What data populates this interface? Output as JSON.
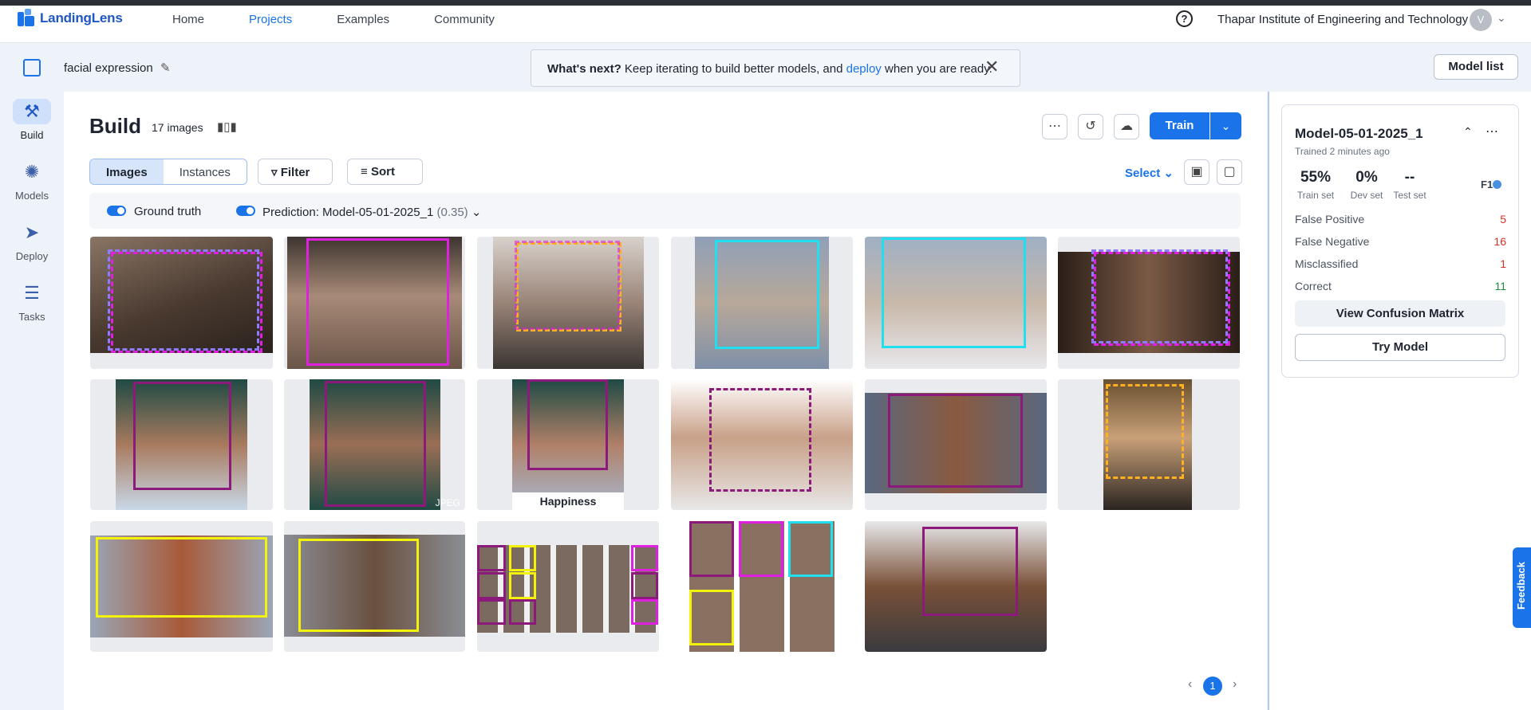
{
  "nav": {
    "logo_text": "LandingLens",
    "links": [
      "Home",
      "Projects",
      "Examples",
      "Community"
    ],
    "help_icon": "?",
    "org": "Thapar Institute of Engineering and Technology",
    "avatar": "V"
  },
  "project": {
    "name": "facial expression",
    "banner_bold": "What's next?",
    "banner_text": "Keep iterating to build better models, and",
    "banner_link": "deploy",
    "banner_tail": "when you are ready.",
    "model_list": "Model list"
  },
  "sidebar": {
    "items": [
      {
        "label": "Build",
        "icon": "tools-icon"
      },
      {
        "label": "Models",
        "icon": "network-icon"
      },
      {
        "label": "Deploy",
        "icon": "rocket-icon"
      },
      {
        "label": "Tasks",
        "icon": "list-icon"
      }
    ]
  },
  "build": {
    "title": "Build",
    "count": "17 images",
    "train": "Train",
    "tabs": [
      "Images",
      "Instances"
    ],
    "filter": "Filter",
    "sort": "Sort",
    "select": "Select",
    "ground_truth": "Ground truth",
    "prediction_label": "Prediction: Model-05-01-2025_1",
    "prediction_threshold": "(0.35)",
    "caption_happiness": "Happiness",
    "jpeg_mark": "JPEG"
  },
  "colors": {
    "accent": "#1a73e8",
    "anger": "#e020e0",
    "fear": "#20e0f0",
    "happiness": "#8b1a7a",
    "sadness": "#f2f20a",
    "disgust": "#ffb020"
  },
  "pagination": {
    "current": "1"
  },
  "model_card": {
    "name": "Model-05-01-2025_1",
    "trained": "Trained 2 minutes ago",
    "metrics": [
      {
        "value": "55%",
        "label": "Train set"
      },
      {
        "value": "0%",
        "label": "Dev set"
      },
      {
        "value": "--",
        "label": "Test set"
      }
    ],
    "metric_type": "F1",
    "stats": [
      {
        "label": "False Positive",
        "value": "5",
        "color": "#d93025"
      },
      {
        "label": "False Negative",
        "value": "16",
        "color": "#d93025"
      },
      {
        "label": "Misclassified",
        "value": "1",
        "color": "#d93025"
      },
      {
        "label": "Correct",
        "value": "11",
        "color": "#1e8e3e"
      }
    ],
    "confusion": "View Confusion Matrix",
    "try": "Try Model"
  },
  "feedback": "Feedback"
}
